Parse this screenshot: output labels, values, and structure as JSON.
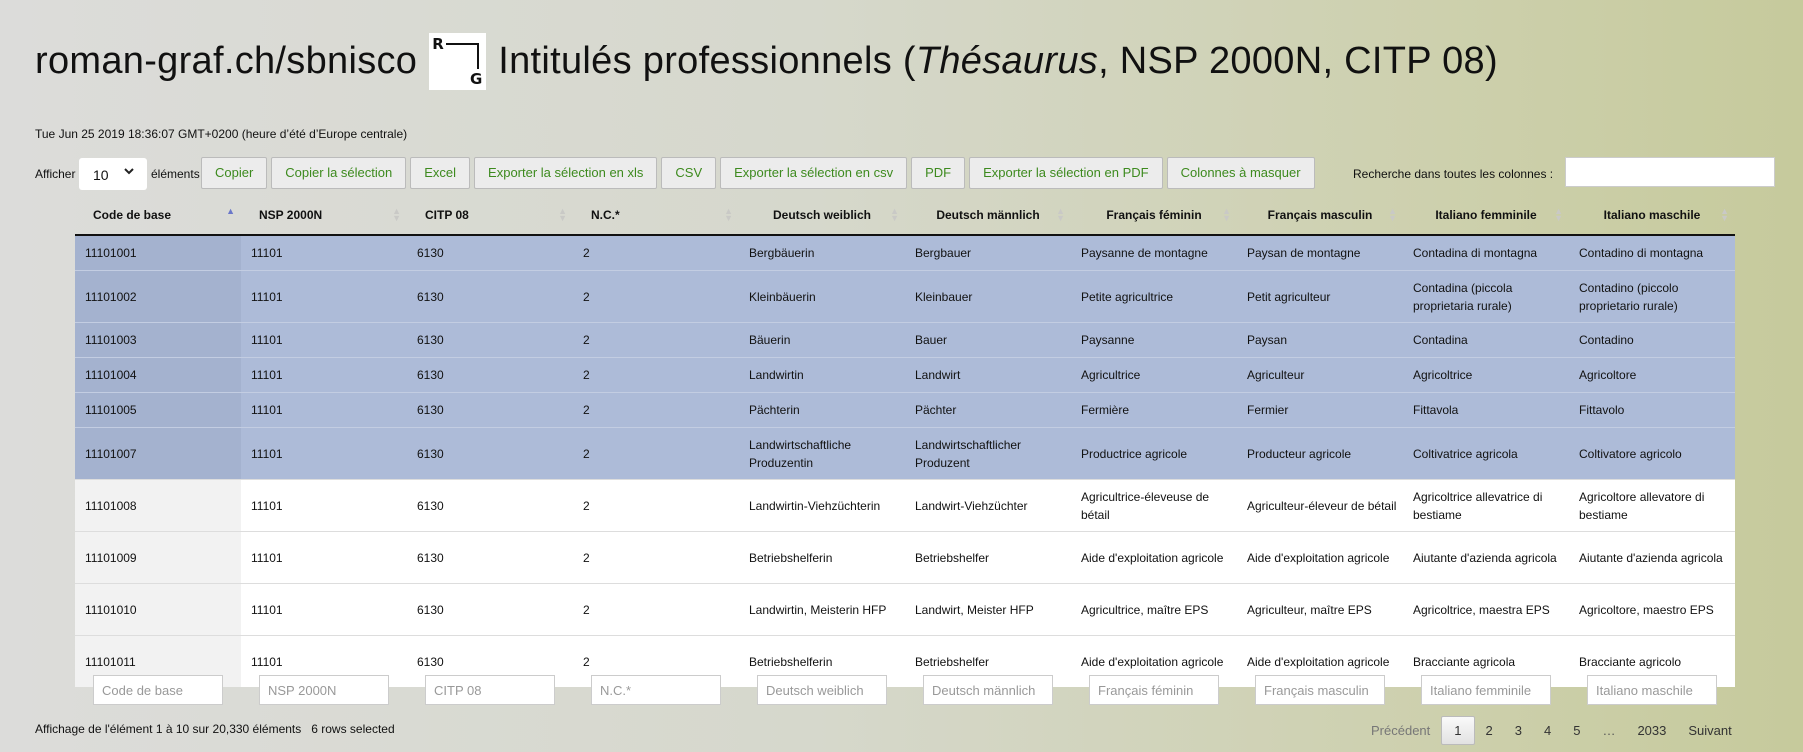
{
  "header": {
    "site": "roman-graf.ch/sbnisco",
    "title_pre": "Intitulés professionnels (",
    "title_em": "Thésaurus",
    "title_post": ", NSP 2000N, CITP 08)",
    "logo_r": "R",
    "logo_g": "G"
  },
  "timestamp": "Tue Jun 25 2019 18:36:07 GMT+0200 (heure d’été d’Europe centrale)",
  "length": {
    "label_before": "Afficher",
    "value": "10",
    "label_after": "éléments"
  },
  "buttons": {
    "copy": "Copier",
    "copy_sel": "Copier la sélection",
    "excel": "Excel",
    "xls_sel": "Exporter la sélection en xls",
    "csv": "CSV",
    "csv_sel": "Exporter la sélection en csv",
    "pdf": "PDF",
    "pdf_sel": "Exporter la sélection en PDF",
    "cols": "Colonnes à masquer"
  },
  "search": {
    "label": "Recherche dans toutes les colonnes :",
    "value": ""
  },
  "columns": [
    "Code de base",
    "NSP 2000N",
    "CITP 08",
    "N.C.*",
    "Deutsch weiblich",
    "Deutsch männlich",
    "Français féminin",
    "Français masculin",
    "Italiano femminile",
    "Italiano maschile"
  ],
  "rows": [
    {
      "selected": true,
      "cells": [
        "11101001",
        "11101",
        "6130",
        "2",
        "Bergbäuerin",
        "Bergbauer",
        "Paysanne de montagne",
        "Paysan de montagne",
        "Contadina di montagna",
        "Contadino di montagna"
      ]
    },
    {
      "selected": true,
      "cells": [
        "11101002",
        "11101",
        "6130",
        "2",
        "Kleinbäuerin",
        "Kleinbauer",
        "Petite agricultrice",
        "Petit agriculteur",
        "Contadina (piccola proprietaria rurale)",
        "Contadino (piccolo proprietario rurale)"
      ]
    },
    {
      "selected": true,
      "cells": [
        "11101003",
        "11101",
        "6130",
        "2",
        "Bäuerin",
        "Bauer",
        "Paysanne",
        "Paysan",
        "Contadina",
        "Contadino"
      ]
    },
    {
      "selected": true,
      "cells": [
        "11101004",
        "11101",
        "6130",
        "2",
        "Landwirtin",
        "Landwirt",
        "Agricultrice",
        "Agriculteur",
        "Agricoltrice",
        "Agricoltore"
      ]
    },
    {
      "selected": true,
      "cells": [
        "11101005",
        "11101",
        "6130",
        "2",
        "Pächterin",
        "Pächter",
        "Fermière",
        "Fermier",
        "Fittavola",
        "Fittavolo"
      ]
    },
    {
      "selected": true,
      "cells": [
        "11101007",
        "11101",
        "6130",
        "2",
        "Landwirtschaftliche Produzentin",
        "Landwirtschaftlicher Produzent",
        "Productrice agricole",
        "Producteur agricole",
        "Coltivatrice agricola",
        "Coltivatore agricolo"
      ]
    },
    {
      "selected": false,
      "cells": [
        "11101008",
        "11101",
        "6130",
        "2",
        "Landwirtin-Viehzüchterin",
        "Landwirt-Viehzüchter",
        "Agricultrice-éleveuse de bétail",
        "Agriculteur-éleveur de bétail",
        "Agricoltrice allevatrice di bestiame",
        "Agricoltore allevatore di bestiame"
      ]
    },
    {
      "selected": false,
      "cells": [
        "11101009",
        "11101",
        "6130",
        "2",
        "Betriebshelferin",
        "Betriebshelfer",
        "Aide d'exploitation agricole",
        "Aide d'exploitation agricole",
        "Aiutante d'azienda agricola",
        "Aiutante d'azienda agricola"
      ]
    },
    {
      "selected": false,
      "cells": [
        "11101010",
        "11101",
        "6130",
        "2",
        "Landwirtin, Meisterin HFP",
        "Landwirt, Meister HFP",
        "Agricultrice, maître EPS",
        "Agriculteur, maître EPS",
        "Agricoltrice, maestra EPS",
        "Agricoltore, maestro EPS"
      ]
    },
    {
      "selected": false,
      "cells": [
        "11101011",
        "11101",
        "6130",
        "2",
        "Betriebshelferin",
        "Betriebshelfer",
        "Aide d'exploitation agricole",
        "Aide d'exploitation agricole",
        "Bracciante agricola",
        "Bracciante agricolo"
      ]
    }
  ],
  "filters": [
    "Code de base",
    "NSP 2000N",
    "CITP 08",
    "N.C.*",
    "Deutsch weiblich",
    "Deutsch männlich",
    "Français féminin",
    "Français masculin",
    "Italiano femminile",
    "Italiano maschile"
  ],
  "info": {
    "text": "Affichage de l'élément 1 à 10 sur 20,330 éléments",
    "selected": "6 rows selected"
  },
  "pager": {
    "prev": "Précédent",
    "pages": [
      "1",
      "2",
      "3",
      "4",
      "5"
    ],
    "ellipsis": "…",
    "last": "2033",
    "next": "Suivant",
    "current": "1"
  }
}
